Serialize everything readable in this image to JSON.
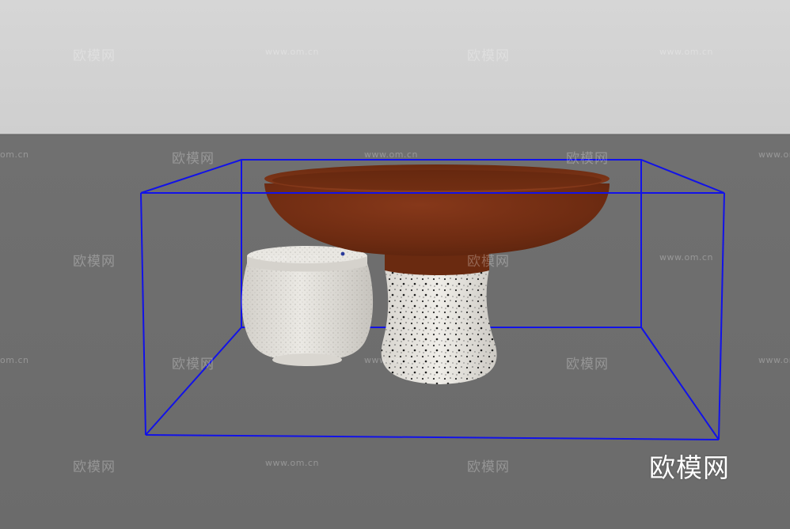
{
  "scene": {
    "colors": {
      "wall": "#d4d4d4",
      "floor": "#6e6e6e",
      "bounding_box": "#1010ee",
      "bowl_top": "#7a3418",
      "bowl_body": "#6e2c12",
      "stone": "#e0ddd6",
      "speckle": "#2a2a2a"
    },
    "objects": [
      "wooden-bowl",
      "granite-pedestal",
      "stone-jar",
      "selection-bounding-box"
    ]
  },
  "watermarks": {
    "cn": "欧模网",
    "url": "www.om.cn",
    "url_partial": "om.cn",
    "url_clipped": "www.om.cn"
  },
  "logo": {
    "text": "欧模网"
  }
}
